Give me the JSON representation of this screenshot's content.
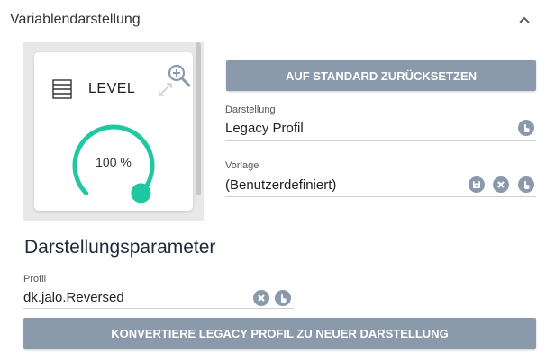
{
  "section": {
    "title": "Variablendarstellung",
    "collapse_icon": "chevron-up-icon"
  },
  "preview": {
    "tile_title": "LEVEL",
    "tile_icon": "blinds-icon",
    "zoom_icon": "zoom-in-icon",
    "expand_icon": "expand-icon",
    "gauge_value": "100 %",
    "gauge_level": 1.0,
    "gauge_color": "#1fc8a0"
  },
  "reset_button": {
    "label": "AUF STANDARD ZURÜCKSETZEN"
  },
  "darstellung": {
    "label": "Darstellung",
    "value": "Legacy Profil",
    "select_icon": "hand-pointer-icon"
  },
  "vorlage": {
    "label": "Vorlage",
    "value": "(Benutzerdefiniert)",
    "icons": [
      "save-icon",
      "clear-icon",
      "hand-pointer-icon"
    ]
  },
  "parameters": {
    "title": "Darstellungsparameter",
    "profile_label": "Profil",
    "profile_value": "dk.jalo.Reversed",
    "icons": [
      "clear-icon",
      "hand-pointer-icon"
    ]
  },
  "convert_button": {
    "label": "KONVERTIERE LEGACY PROFIL ZU NEUER DARSTELLUNG"
  },
  "colors": {
    "button_bg": "#8a9aab",
    "accent": "#1fc8a0"
  }
}
